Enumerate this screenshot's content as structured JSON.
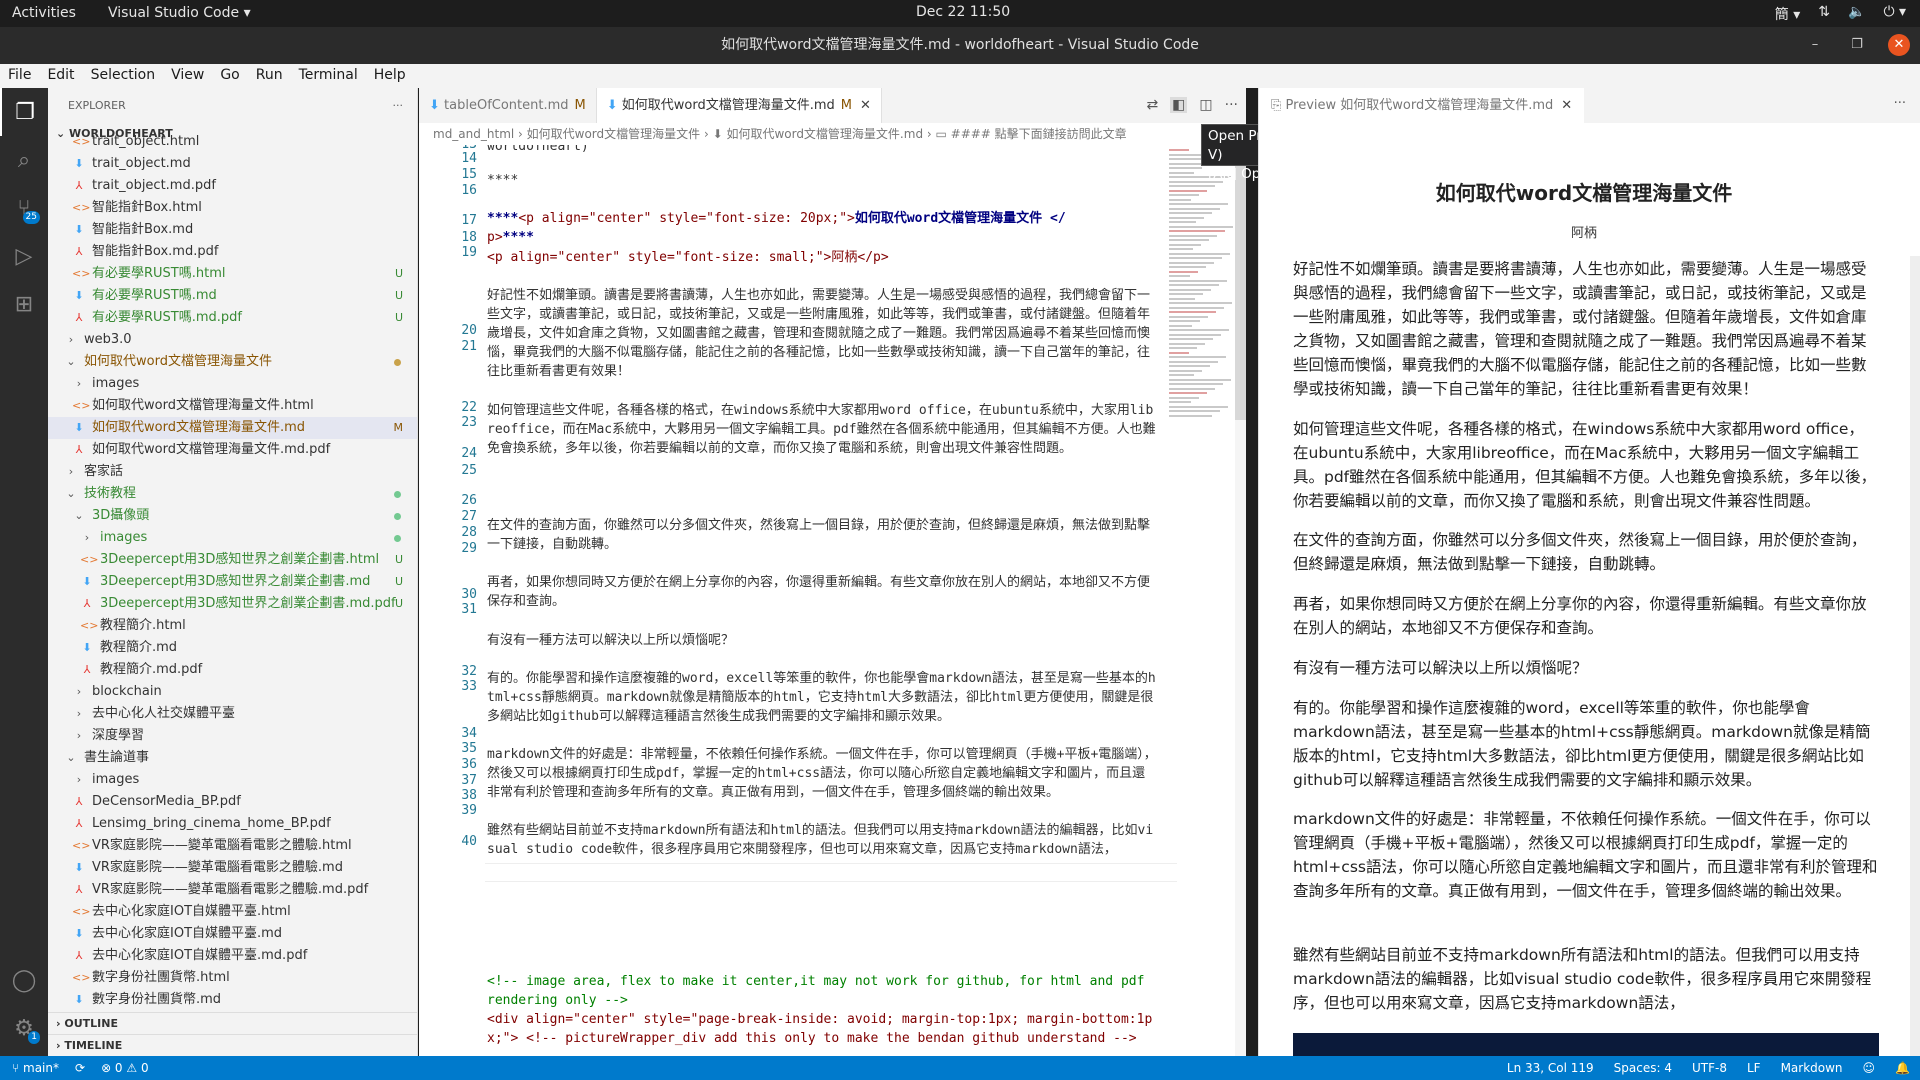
{
  "topbar": {
    "activities": "Activities",
    "app_menu": "Visual Studio Code ▾",
    "clock": "Dec 22  11:50",
    "lang": "簡 ▾"
  },
  "window": {
    "title": "如何取代word文檔管理海量文件.md - worldofheart - Visual Studio Code"
  },
  "menu": [
    "File",
    "Edit",
    "Selection",
    "View",
    "Go",
    "Run",
    "Terminal",
    "Help"
  ],
  "activity": {
    "scm_badge": "25",
    "settings_badge": "1"
  },
  "explorer": {
    "header": "EXPLORER",
    "more": "···",
    "root": "WORLDOFHEART",
    "rows": [
      {
        "label": "trait_object.html",
        "type": "html",
        "indent": 1
      },
      {
        "label": "trait_object.md",
        "type": "md",
        "indent": 1
      },
      {
        "label": "trait_object.md.pdf",
        "type": "pdf",
        "indent": 1
      },
      {
        "label": "智能指針Box.html",
        "type": "html",
        "indent": 1
      },
      {
        "label": "智能指針Box.md",
        "type": "md",
        "indent": 1
      },
      {
        "label": "智能指針Box.md.pdf",
        "type": "pdf",
        "indent": 1
      },
      {
        "label": "有必要學RUST嗎.html",
        "type": "html",
        "indent": 1,
        "status": "U",
        "green": true
      },
      {
        "label": "有必要學RUST嗎.md",
        "type": "md",
        "indent": 1,
        "status": "U",
        "green": true
      },
      {
        "label": "有必要學RUST嗎.md.pdf",
        "type": "pdf",
        "indent": 1,
        "status": "U",
        "green": true
      },
      {
        "label": "web3.0",
        "type": "folder",
        "indent": 0,
        "chev": "›"
      },
      {
        "label": "如何取代word文檔管理海量文件",
        "type": "folder",
        "indent": 0,
        "chev": "⌄",
        "dot": "#c9a24a",
        "modified": true
      },
      {
        "label": "images",
        "type": "folder",
        "indent": 1,
        "chev": "›"
      },
      {
        "label": "如何取代word文檔管理海量文件.html",
        "type": "html",
        "indent": 1
      },
      {
        "label": "如何取代word文檔管理海量文件.md",
        "type": "md",
        "indent": 1,
        "status": "M",
        "selected": true,
        "modified": true
      },
      {
        "label": "如何取代word文檔管理海量文件.md.pdf",
        "type": "pdf",
        "indent": 1
      },
      {
        "label": "客家話",
        "type": "folder",
        "indent": 0,
        "chev": "›"
      },
      {
        "label": "技術教程",
        "type": "folder",
        "indent": 0,
        "chev": "⌄",
        "dot": "#73c991",
        "green": true
      },
      {
        "label": "3D攝像頭",
        "type": "folder",
        "indent": 1,
        "chev": "⌄",
        "dot": "#73c991",
        "green": true
      },
      {
        "label": "images",
        "type": "folder",
        "indent": 2,
        "chev": "›",
        "dot": "#73c991",
        "green": true
      },
      {
        "label": "3Deepercept用3D感知世界之創業企劃書.html",
        "type": "html",
        "indent": 2,
        "status": "U",
        "green": true
      },
      {
        "label": "3Deepercept用3D感知世界之創業企劃書.md",
        "type": "md",
        "indent": 2,
        "status": "U",
        "green": true
      },
      {
        "label": "3Deepercept用3D感知世界之創業企劃書.md.pdf",
        "type": "pdf",
        "indent": 2,
        "status": "U",
        "green": true
      },
      {
        "label": "教程簡介.html",
        "type": "html",
        "indent": 2
      },
      {
        "label": "教程簡介.md",
        "type": "md",
        "indent": 2
      },
      {
        "label": "教程簡介.md.pdf",
        "type": "pdf",
        "indent": 2
      },
      {
        "label": "blockchain",
        "type": "folder",
        "indent": 1,
        "chev": "›"
      },
      {
        "label": "去中心化人社交媒體平臺",
        "type": "folder",
        "indent": 1,
        "chev": "›"
      },
      {
        "label": "深度學習",
        "type": "folder",
        "indent": 1,
        "chev": "›"
      },
      {
        "label": "書生論道事",
        "type": "folder",
        "indent": 0,
        "chev": "⌄"
      },
      {
        "label": "images",
        "type": "folder",
        "indent": 1,
        "chev": "›"
      },
      {
        "label": "DeCensorMedia_BP.pdf",
        "type": "pdf",
        "indent": 1
      },
      {
        "label": "Lensimg_bring_cinema_home_BP.pdf",
        "type": "pdf",
        "indent": 1
      },
      {
        "label": "VR家庭影院——變革電腦看電影之體驗.html",
        "type": "html",
        "indent": 1
      },
      {
        "label": "VR家庭影院——變革電腦看電影之體驗.md",
        "type": "md",
        "indent": 1
      },
      {
        "label": "VR家庭影院——變革電腦看電影之體驗.md.pdf",
        "type": "pdf",
        "indent": 1
      },
      {
        "label": "去中心化家庭IOT自媒體平臺.html",
        "type": "html",
        "indent": 1
      },
      {
        "label": "去中心化家庭IOT自媒體平臺.md",
        "type": "md",
        "indent": 1
      },
      {
        "label": "去中心化家庭IOT自媒體平臺.md.pdf",
        "type": "pdf",
        "indent": 1
      },
      {
        "label": "數字身份社團貨幣.html",
        "type": "html",
        "indent": 1
      },
      {
        "label": "數字身份社團貨幣.md",
        "type": "md",
        "indent": 1
      }
    ],
    "outline": "OUTLINE",
    "timeline": "TIMELINE"
  },
  "tabs": [
    {
      "label": "tableOfContent.md",
      "mark": "M",
      "active": false
    },
    {
      "label": "如何取代word文檔管理海量文件.md",
      "mark": "M",
      "active": true
    }
  ],
  "breadcrumb": "md_and_html › 如何取代word文檔管理海量文件 › ⬇ 如何取代word文檔管理海量文件.md › ▭ #### 點擊下面鏈接訪問此文章",
  "tooltip": {
    "line1": "Open Preview to the Side (Ctrl+K V)",
    "line2": "[Alt] Open Preview (Ctrl+Shift+V)"
  },
  "editor": {
    "lines": [
      {
        "n": "",
        "text": "worldofheart)",
        "y": -7
      },
      {
        "n": "13",
        "text": "",
        "y": 0
      },
      {
        "n": "14",
        "text": "****",
        "y": 0
      },
      {
        "n": "15",
        "text": "",
        "y": 0
      },
      {
        "n": "16",
        "text": "",
        "y": 0
      },
      {
        "n": "17",
        "text": "",
        "y": 0
      },
      {
        "n": "18",
        "text": "",
        "y": 0
      },
      {
        "n": "19",
        "text": "好記性不如爛筆頭。讀書是要將書讀薄，人生也亦如此，需要變薄。人生是一場感受與感悟的過程，我們總會留下一些文字，或讀書筆記，或日記，或技術筆記，又或是一些附庸風雅，如此等等，我們或筆書，或付諸鍵盤。但隨着年歲增長，文件如倉庫之貨物，又如圖書館之藏書，管理和查閱就隨之成了一難題。我們常因爲遍尋不着某些回憶而懊惱，畢竟我們的大腦不似電腦存儲，能記住之前的各種記憶，比如一些數學或技術知識，讀一下自己當年的筆記，往往比重新看書更有效果！"
      },
      {
        "n": "20",
        "text": ""
      },
      {
        "n": "21",
        "text": "如何管理這些文件呢，各種各樣的格式，在windows系統中大家都用word office，在ubuntu系統中，大家用libreoffice，而在Mac系統中，大夥用另一個文字編輯工具。pdf雖然在各個系統中能通用，但其編輯不方便。人也難免會換系統，多年以後，你若要編輯以前的文章，而你又換了電腦和系統，則會出現文件兼容性問題。"
      },
      {
        "n": "22",
        "text": ""
      },
      {
        "n": "23",
        "text": "在文件的查詢方面，你雖然可以分多個文件夾，然後寫上一個目錄，用於便於查詢，但終歸還是麻煩，無法做到點擊一下鏈接，自動跳轉。"
      },
      {
        "n": "24",
        "text": ""
      },
      {
        "n": "25",
        "text": "再者，如果你想同時又方便於在網上分享你的內容，你還得重新編輯。有些文章你放在別人的網站，本地卻又不方便保存和查詢。"
      },
      {
        "n": "26",
        "text": ""
      },
      {
        "n": "27",
        "text": "有沒有一種方法可以解決以上所以煩惱呢？"
      },
      {
        "n": "28",
        "text": ""
      },
      {
        "n": "29",
        "text": "有的。你能學習和操作這麼複雜的word，excell等笨重的軟件，你也能學會markdown語法，甚至是寫一些基本的html+css靜態網頁。markdown就像是精簡版本的html，它支持html大多數語法，卻比html更方便使用，關鍵是很多網站比如github可以解釋這種語言然後生成我們需要的文字編排和顯示效果。"
      },
      {
        "n": "30",
        "text": ""
      },
      {
        "n": "31",
        "text": "markdown文件的好處是：非常輕量，不依賴任何操作系統。一個文件在手，你可以管理網頁（手機+平板+電腦端），然後又可以根據網頁打印生成pdf，掌握一定的html+css語法，你可以隨心所慾自定義地編輯文字和圖片，而且還非常有利於管理和查詢多年所有的文章。真正做有用到，一個文件在手，管理多個終端的輸出效果。"
      },
      {
        "n": "32",
        "text": ""
      },
      {
        "n": "33",
        "text": "雖然有些網站目前並不支持markdown所有語法和html的語法。但我們可以用支持markdown語法的編輯器，比如visual studio code軟件，很多程序員用它來開發程序，但也可以用來寫文章，因爲它支持markdown語法，"
      },
      {
        "n": "34",
        "text": ""
      },
      {
        "n": "35",
        "text": ""
      },
      {
        "n": "36",
        "text": ""
      },
      {
        "n": "37",
        "text": ""
      },
      {
        "n": "38",
        "text": ""
      },
      {
        "n": "39",
        "text": ""
      },
      {
        "n": "40",
        "text": ""
      }
    ],
    "l16a": "****",
    "l16b": "<p align=\"center\" style=\"font-size: 20px;\">",
    "l16c": "如何取代word文檔管理海量文件 </",
    "l16d": "p>",
    "l16e": "****",
    "l17": "<p align=\"center\" style=\"font-size: small;\">阿柄</p>",
    "l39": "<!-- image area, flex to make it center,it may not work for github, for html and pdf rendering only -->",
    "l40": "<div align=\"center\" style=\"page-break-inside: avoid; margin-top:1px; margin-bottom:1px;\"> <!-- pictureWrapper_div add this only to make the bendan github understand -->"
  },
  "preview": {
    "tab": "Preview 如何取代word文檔管理海量文件.md",
    "title": "如何取代word文檔管理海量文件",
    "author": "阿柄",
    "paragraphs": [
      "好記性不如爛筆頭。讀書是要將書讀薄，人生也亦如此，需要變薄。人生是一場感受與感悟的過程，我們總會留下一些文字，或讀書筆記，或日記，或技術筆記，又或是一些附庸風雅，如此等等，我們或筆書，或付諸鍵盤。但隨着年歲增長，文件如倉庫之貨物，又如圖書館之藏書，管理和查閱就隨之成了一難題。我們常因爲遍尋不着某些回憶而懊惱，畢竟我們的大腦不似電腦存儲，能記住之前的各種記憶，比如一些數學或技術知識，讀一下自己當年的筆記，往往比重新看書更有效果！",
      "如何管理這些文件呢，各種各樣的格式，在windows系統中大家都用word office，在ubuntu系統中，大家用libreoffice，而在Mac系統中，大夥用另一個文字編輯工具。pdf雖然在各個系統中能通用，但其編輯不方便。人也難免會換系統，多年以後，你若要編輯以前的文章，而你又換了電腦和系統，則會出現文件兼容性問題。",
      "在文件的查詢方面，你雖然可以分多個文件夾，然後寫上一個目錄，用於便於查詢，但終歸還是麻煩，無法做到點擊一下鏈接，自動跳轉。",
      "再者，如果你想同時又方便於在網上分享你的內容，你還得重新編輯。有些文章你放在別人的網站，本地卻又不方便保存和查詢。",
      "有沒有一種方法可以解決以上所以煩惱呢？",
      "有的。你能學習和操作這麼複雜的word，excell等笨重的軟件，你也能學會markdown語法，甚至是寫一些基本的html+css靜態網頁。markdown就像是精簡版本的html，它支持html大多數語法，卻比html更方便使用，關鍵是很多網站比如github可以解釋這種語言然後生成我們需要的文字編排和顯示效果。",
      "markdown文件的好處是：非常輕量，不依賴任何操作系統。一個文件在手，你可以管理網頁（手機+平板+電腦端），然後又可以根據網頁打印生成pdf，掌握一定的html+css語法，你可以隨心所慾自定義地編輯文字和圖片，而且還非常有利於管理和查詢多年所有的文章。真正做有用到，一個文件在手，管理多個終端的輸出效果。",
      "雖然有些網站目前並不支持markdown所有語法和html的語法。但我們可以用支持markdown語法的編輯器，比如visual studio code軟件，很多程序員用它來開發程序，但也可以用來寫文章，因爲它支持markdown語法，"
    ]
  },
  "status": {
    "branch": "main*",
    "problems": "⊗ 0 ⚠ 0",
    "position": "Ln 33, Col 119",
    "spaces": "Spaces: 4",
    "encoding": "UTF-8",
    "eol": "LF",
    "language": "Markdown"
  }
}
